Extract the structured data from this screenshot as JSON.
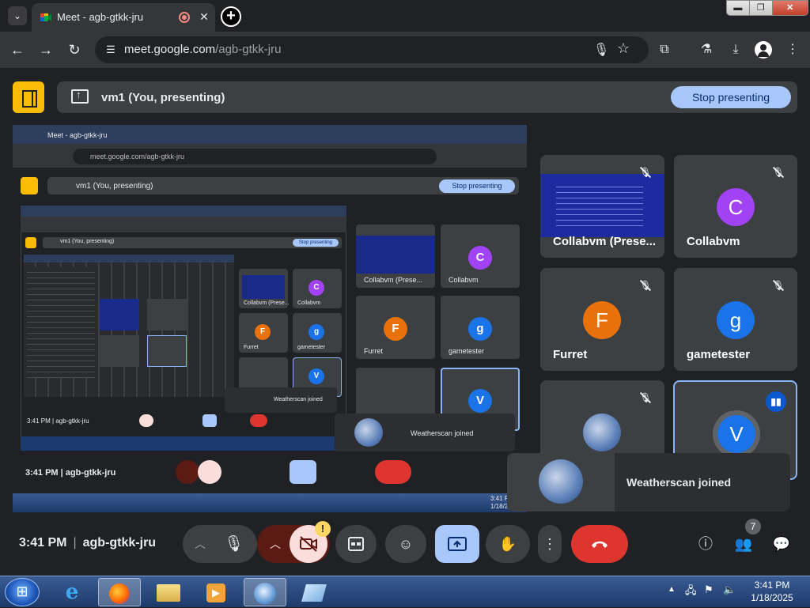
{
  "browser": {
    "tab_title": "Meet - agb-gtkk-jru",
    "tab_close": "✕",
    "new_tab": "+",
    "url_host": "meet.google.com",
    "url_path": "/agb-gtkk-jru",
    "window_buttons": {
      "minimize": "▬",
      "maximize": "❐",
      "close": "✕"
    }
  },
  "meet": {
    "presenting_label": "vm1 (You, presenting)",
    "stop_presenting": "Stop presenting",
    "participants": [
      {
        "name": "Collabvm (Prese...",
        "kind": "screen",
        "muted": true
      },
      {
        "name": "Collabvm",
        "initial": "C",
        "color": "#a142f4",
        "muted": true
      },
      {
        "name": "Furret",
        "initial": "F",
        "color": "#e8710a",
        "muted": true
      },
      {
        "name": "gametester",
        "initial": "g",
        "color": "#1a73e8",
        "muted": true
      },
      {
        "name": "",
        "kind": "photo",
        "muted": true
      },
      {
        "name": "",
        "initial": "V",
        "color": "#1a73e8",
        "speaking": true
      }
    ],
    "toast": "Weatherscan joined",
    "time": "3:41 PM",
    "meeting_code": "agb-gtkk-jru",
    "people_count": "7",
    "warning_badge": "!"
  },
  "nested": {
    "tab_title": "Meet - agb-gtkk-jru",
    "url": "meet.google.com/agb-gtkk-jru",
    "presenting_label": "vm1 (You, presenting)",
    "stop_presenting": "Stop presenting",
    "names": [
      "Collabvm (Prese...",
      "Collabvm",
      "Furret",
      "gametester"
    ],
    "initials": [
      "C",
      "F",
      "g",
      "V"
    ],
    "toast": "Weatherscan joined",
    "time": "3:41 PM",
    "meeting_code": "agb-gtkk-jru",
    "nested2_presenting": "vm1 (You, presenting)",
    "nested2_stop": "Stop presenting",
    "nested2_names": [
      "Collabvm (Prese...",
      "Collabvm",
      "Furret",
      "gametester"
    ],
    "nested2_toast": "Weatherscan joined",
    "nested2_time": "3:41 PM",
    "nested2_code": "agb-gtkk-jru",
    "clock_time": "3:41 PM",
    "clock_date": "1/18/2025"
  },
  "taskbar": {
    "clock_time": "3:41 PM",
    "clock_date": "1/18/2025"
  },
  "colors": {
    "accent_blue": "#a8c7fa",
    "leave_red": "#dc362e",
    "logo_yellow": "#fbbc04"
  }
}
